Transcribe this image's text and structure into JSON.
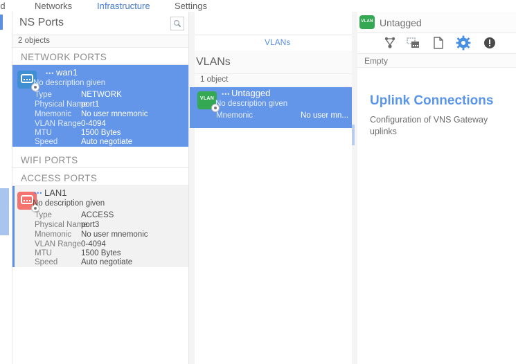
{
  "topnav": {
    "items": [
      {
        "label": "rd",
        "active": false
      },
      {
        "label": "Networks",
        "active": false
      },
      {
        "label": "Infrastructure",
        "active": true
      },
      {
        "label": "Settings",
        "active": false
      }
    ]
  },
  "colors": {
    "accent_blue": "#5b8fe0",
    "selection_blue": "#6395e8",
    "selection_grey": "#f2f2f2",
    "icon_blue": "#3f8fd2",
    "icon_red": "#f4736f",
    "icon_green": "#34a853"
  },
  "left_panel": {
    "title": "NS Ports",
    "search_icon": "search-icon",
    "count": "2 objects",
    "sections": [
      {
        "label": "NETWORK PORTS"
      },
      {
        "label": "WIFI PORTS"
      },
      {
        "label": "ACCESS PORTS"
      }
    ],
    "network_port": {
      "name": "wan1",
      "description": "No description given",
      "icon": "network-port-icon",
      "rows": [
        {
          "label": "Type",
          "value": "NETWORK"
        },
        {
          "label": "Physical Name",
          "value": "port1"
        },
        {
          "label": "Mnemonic",
          "value": "No user mnemonic"
        },
        {
          "label": "VLAN Range",
          "value": "0-4094"
        },
        {
          "label": "MTU",
          "value": "1500 Bytes"
        },
        {
          "label": "Speed",
          "value": "Auto negotiate"
        }
      ]
    },
    "access_port": {
      "name": "LAN1",
      "description": "No description given",
      "icon": "access-port-icon",
      "rows": [
        {
          "label": "Type",
          "value": "ACCESS"
        },
        {
          "label": "Physical Name",
          "value": "port3"
        },
        {
          "label": "Mnemonic",
          "value": "No user mnemonic"
        },
        {
          "label": "VLAN Range",
          "value": "0-4094"
        },
        {
          "label": "MTU",
          "value": "1500 Bytes"
        },
        {
          "label": "Speed",
          "value": "Auto negotiate"
        }
      ]
    }
  },
  "middle_panel": {
    "tab_label": "VLANs",
    "title": "VLANs",
    "count": "1 object",
    "vlan": {
      "name": "Untagged",
      "description": "No description given",
      "icon": "vlan-icon",
      "icon_text": "VLAN",
      "rows": [
        {
          "label": "Mnemonic",
          "value": "No user mn..."
        }
      ]
    }
  },
  "right_panel": {
    "icon_text": "VLAN",
    "title": "Untagged",
    "toolbar": [
      {
        "name": "topology-icon",
        "active": false
      },
      {
        "name": "clone-icon",
        "active": false
      },
      {
        "name": "document-icon",
        "active": false
      },
      {
        "name": "gear-icon",
        "active": true
      },
      {
        "name": "alert-icon",
        "active": false
      }
    ],
    "empty_label": "Empty",
    "detail_title": "Uplink Connections",
    "detail_subtitle": "Configuration of VNS Gateway uplinks"
  }
}
